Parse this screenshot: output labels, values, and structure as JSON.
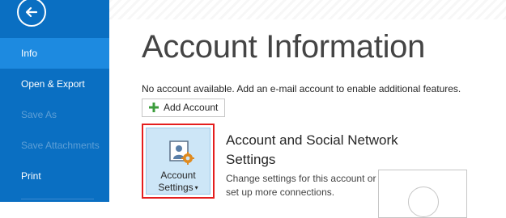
{
  "nav": {
    "back_label": "Back",
    "items": [
      {
        "label": "Info",
        "state": "selected"
      },
      {
        "label": "Open & Export",
        "state": "normal"
      },
      {
        "label": "Save As",
        "state": "disabled"
      },
      {
        "label": "Save Attachments",
        "state": "disabled"
      },
      {
        "label": "Print",
        "state": "normal"
      }
    ]
  },
  "main": {
    "title": "Account Information",
    "notice": "No account available. Add an e-mail account to enable additional features.",
    "add_account_label": "Add Account",
    "account_settings": {
      "line1": "Account",
      "line2": "Settings"
    },
    "section_title": "Account and Social Network Settings",
    "section_desc": "Change settings for this account or set up more connections."
  },
  "colors": {
    "nav_bg": "#0a6fc2",
    "nav_selected": "#1d8ae0",
    "highlight_border": "#e41e1e",
    "plus_green": "#3c9c3c"
  }
}
